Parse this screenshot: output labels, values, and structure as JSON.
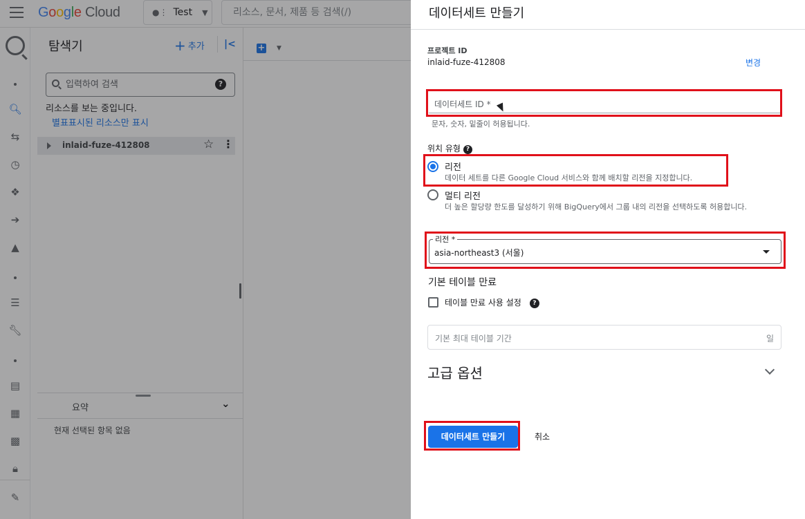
{
  "topbar": {
    "logo_google": "Google",
    "logo_cloud": "Cloud",
    "project_picker_label": "Test",
    "search_placeholder": "리소스, 문서, 제품 등 검색(/)"
  },
  "explorer": {
    "title": "탐색기",
    "add_label": "추가",
    "search_placeholder": "입력하여 검색",
    "viewing_text": "리소스를 보는 중입니다.",
    "starred_link": "별표표시된 리소스만 표시",
    "project_name": "inlaid-fuze-412808",
    "summary_label": "요약",
    "no_selection": "현재 선택된 항목 없음"
  },
  "dialog": {
    "title": "데이터세트 만들기",
    "project_id_label": "프로젝트 ID",
    "project_id_value": "inlaid-fuze-412808",
    "change_link": "변경",
    "dataset_id_placeholder": "데이터세트 ID *",
    "dataset_id_hint": "문자, 숫자, 밑줄이 허용됩니다.",
    "location_type_label": "위치 유형",
    "location_options": [
      {
        "title": "리전",
        "description": "데이터 세트를 다른 Google Cloud 서비스와 함께 배치할 리전을 지정합니다.",
        "selected": true
      },
      {
        "title": "멀티 리전",
        "description": "더 높은 할당량 한도를 달성하기 위해 BigQuery에서 그룹 내의 리전을 선택하도록 허용합니다.",
        "selected": false
      }
    ],
    "region_label": "리전 *",
    "region_value": "asia-northeast3 (서울)",
    "default_expiration_heading": "기본 테이블 만료",
    "enable_expiration_label": "테이블 만료 사용 설정",
    "max_age_placeholder": "기본 최대 테이블 기간",
    "max_age_suffix": "일",
    "advanced_options": "고급 옵션",
    "create_button": "데이터세트 만들기",
    "cancel_button": "취소"
  },
  "colors": {
    "accent": "#1a73e8",
    "annotation_red": "#e0101a"
  }
}
